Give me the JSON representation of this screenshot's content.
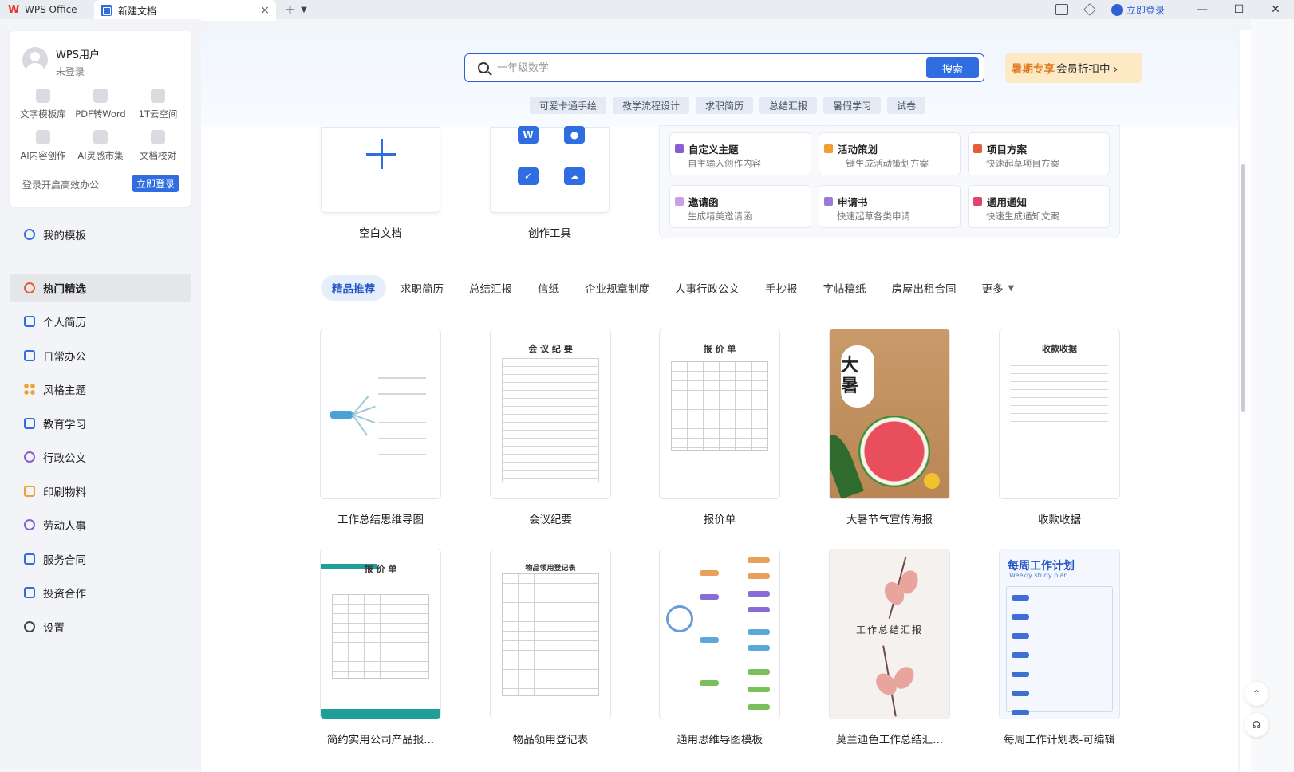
{
  "titlebar": {
    "app_name": "WPS Office",
    "doc_tab": "新建文档",
    "login": "立即登录"
  },
  "user": {
    "name": "WPS用户",
    "status": "未登录",
    "tools": [
      "文字模板库",
      "PDF转Word",
      "1T云空间",
      "AI内容创作",
      "AI灵感市集",
      "文档校对"
    ],
    "login_prompt": "登录开启高效办公",
    "login_button": "立即登录"
  },
  "sidebar": {
    "my_templates": "我的模板",
    "items": [
      {
        "label": "热门精选",
        "icon": "heart-icon",
        "active": true
      },
      {
        "label": "个人简历",
        "icon": "resume-icon"
      },
      {
        "label": "日常办公",
        "icon": "monitor-icon"
      },
      {
        "label": "风格主题",
        "icon": "grid-icon"
      },
      {
        "label": "教育学习",
        "icon": "book-icon"
      },
      {
        "label": "行政公文",
        "icon": "badge-icon"
      },
      {
        "label": "印刷物料",
        "icon": "printer-icon"
      },
      {
        "label": "劳动人事",
        "icon": "person-icon"
      },
      {
        "label": "服务合同",
        "icon": "bookmark-icon"
      },
      {
        "label": "投资合作",
        "icon": "edit-icon"
      },
      {
        "label": "设置",
        "icon": "gear-icon"
      }
    ]
  },
  "search": {
    "placeholder": "一年级数学",
    "button": "搜索"
  },
  "promo": {
    "highlight": "暑期专享",
    "text": "会员折扣中 ›"
  },
  "hot_tags": [
    "可爱卡通手绘",
    "教学流程设计",
    "求职简历",
    "总结汇报",
    "暑假学习",
    "试卷"
  ],
  "create": {
    "blank_doc": "空白文档",
    "tools": "创作工具"
  },
  "ai_cards": [
    {
      "title": "自定义主题",
      "sub": "自主输入创作内容",
      "color": "#8a5cd6"
    },
    {
      "title": "活动策划",
      "sub": "一键生成活动策划方案",
      "color": "#f0a030"
    },
    {
      "title": "项目方案",
      "sub": "快速起草项目方案",
      "color": "#e55d3b"
    },
    {
      "title": "邀请函",
      "sub": "生成精美邀请函",
      "color": "#c9a0e8"
    },
    {
      "title": "申请书",
      "sub": "快速起草各类申请",
      "color": "#9b7ad8"
    },
    {
      "title": "通用通知",
      "sub": "快速生成通知文案",
      "color": "#e0456a"
    }
  ],
  "categories": [
    "精品推荐",
    "求职简历",
    "总结汇报",
    "信纸",
    "企业规章制度",
    "人事行政公文",
    "手抄报",
    "字帖稿纸",
    "房屋出租合同",
    "更多"
  ],
  "templates": [
    {
      "label": "工作总结思维导图"
    },
    {
      "label": "会议纪要",
      "thumb_title": "会 议 纪 要"
    },
    {
      "label": "报价单",
      "thumb_title": "报 价 单"
    },
    {
      "label": "大暑节气宣传海报",
      "poster_text": "大暑"
    },
    {
      "label": "收款收据",
      "thumb_title": "收款收据"
    },
    {
      "label": "简约实用公司产品报...",
      "thumb_title": "报 价 单"
    },
    {
      "label": "物品领用登记表",
      "thumb_title": "物品领用登记表"
    },
    {
      "label": "通用思维导图模板"
    },
    {
      "label": "莫兰迪色工作总结汇...",
      "thumb_title": "工作总结汇报"
    },
    {
      "label": "每周工作计划表-可编辑",
      "thumb_title": "每周工作计划",
      "thumb_sub": "Weekly study plan"
    }
  ]
}
